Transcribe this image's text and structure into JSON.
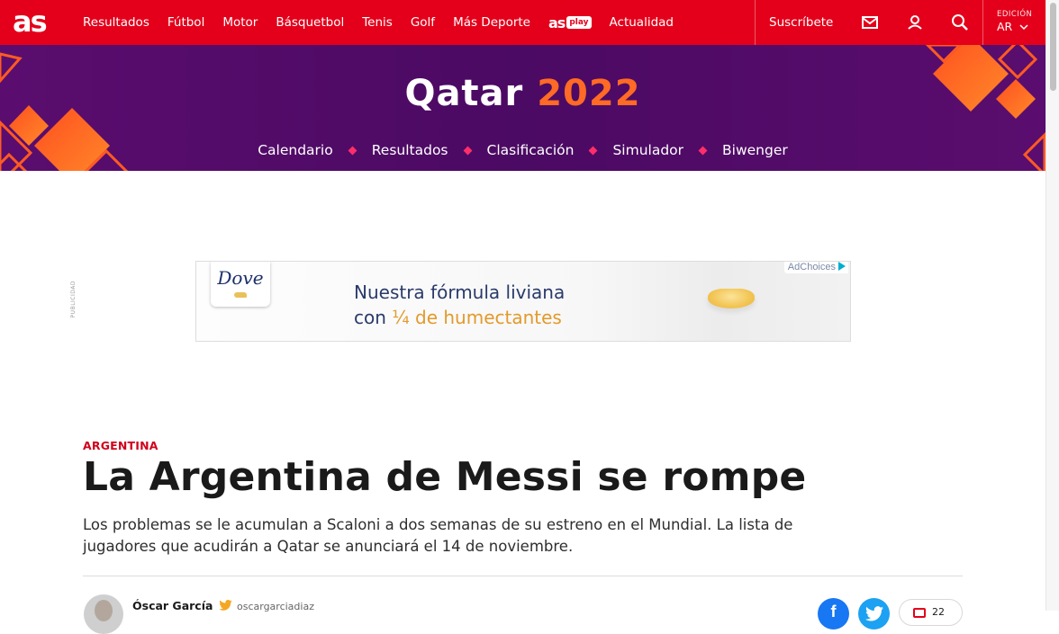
{
  "header": {
    "logo": "as",
    "nav": [
      "Resultados",
      "Fútbol",
      "Motor",
      "Básquetbol",
      "Tenis",
      "Golf",
      "Más Deporte"
    ],
    "asplay_logo": "as",
    "asplay_badge": "play",
    "nav_after": "Actualidad",
    "subscribe": "Suscríbete",
    "edition_label": "EDICIÓN",
    "edition_value": "AR"
  },
  "banner": {
    "title_word": "Qatar",
    "title_year": "2022",
    "nav": [
      "Calendario",
      "Resultados",
      "Clasificación",
      "Simulador",
      "Biwenger"
    ]
  },
  "ad": {
    "label": "PUBLICIDAD",
    "brand": "Dove",
    "line1": "Nuestra fórmula liviana",
    "line2_prefix": "con",
    "line2_highlight": "¼ de humectantes",
    "adchoices": "AdChoices"
  },
  "article": {
    "kicker": "ARGENTINA",
    "headline": "La Argentina de Messi se rompe",
    "subhead": "Los problemas se le acumulan a Scaloni a dos semanas de su estreno en el Mundial. La lista de jugadores que acudirán a Qatar se anunciará el 14 de noviembre.",
    "author": "Óscar García",
    "twitter_handle": "oscargarciadiaz",
    "comment_count": "22"
  },
  "colors": {
    "brand_red": "#e4001b",
    "banner_purple": "#4b0a63",
    "year_orange": "#ff6a24"
  },
  "icons": [
    "mail-icon",
    "user-icon",
    "search-icon",
    "chevron-down-icon",
    "facebook-icon",
    "twitter-icon",
    "comment-icon"
  ]
}
